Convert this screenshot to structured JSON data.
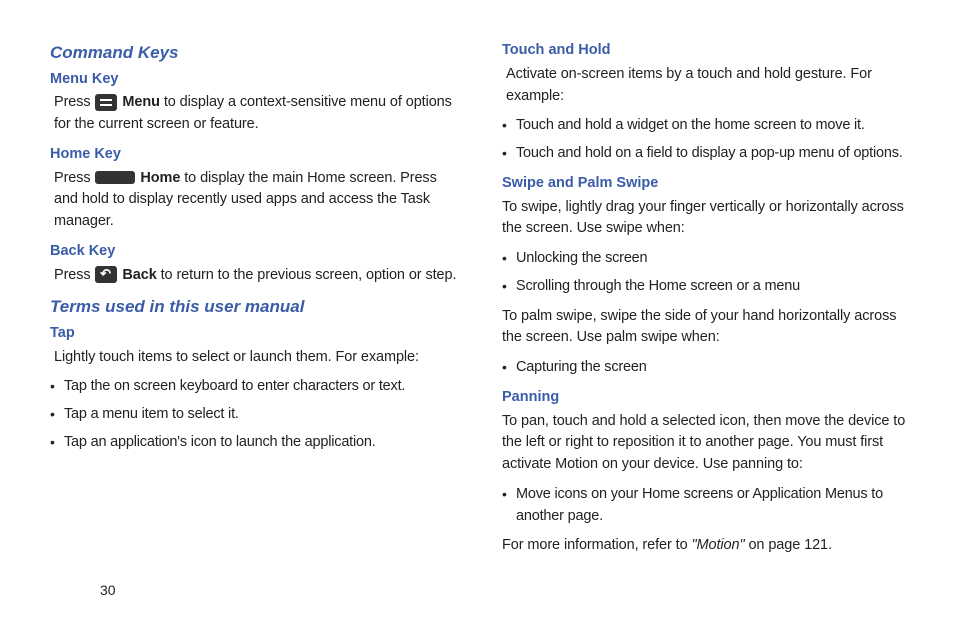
{
  "left": {
    "heading1": "Command Keys",
    "menuKey": {
      "title": "Menu Key",
      "pre": "Press ",
      "label": " Menu",
      "post": " to display a context-sensitive menu of options for the current screen or feature."
    },
    "homeKey": {
      "title": "Home Key",
      "pre": "Press ",
      "label": " Home",
      "post": " to display the main Home screen. Press and hold to display recently used apps and access the Task manager."
    },
    "backKey": {
      "title": "Back Key",
      "pre": "Press ",
      "label": " Back",
      "post": " to return to the previous screen, option or step."
    },
    "heading2": "Terms used in this user manual",
    "tap": {
      "title": "Tap",
      "intro": "Lightly touch items to select or launch them. For example:",
      "items": [
        "Tap the on screen keyboard to enter characters or text.",
        "Tap a menu item to select it.",
        "Tap an application's icon to launch the application."
      ]
    }
  },
  "right": {
    "touchHold": {
      "title": "Touch and Hold",
      "intro": "Activate on-screen items by a touch and hold gesture. For example:",
      "items": [
        "Touch and hold a widget on the home screen to move it.",
        "Touch and hold on a field to display a pop-up menu of options."
      ]
    },
    "swipe": {
      "title": "Swipe and Palm Swipe",
      "intro1": "To swipe, lightly drag your finger vertically or horizontally across the screen. Use swipe when:",
      "items1": [
        "Unlocking the screen",
        "Scrolling through the Home screen or a menu"
      ],
      "intro2": "To palm swipe, swipe the side of your hand horizontally across the screen. Use palm swipe when:",
      "items2": [
        "Capturing the screen"
      ]
    },
    "panning": {
      "title": "Panning",
      "intro": "To pan, touch and hold a selected icon, then move the device to the left or right to reposition it to another page. You must first activate Motion on your device. Use panning to:",
      "items": [
        "Move icons on your Home screens or Application Menus to another page."
      ],
      "ref_pre": "For more information, refer to ",
      "ref_italic": "\"Motion\"",
      "ref_post": "  on page 121."
    }
  },
  "pageNumber": "30"
}
